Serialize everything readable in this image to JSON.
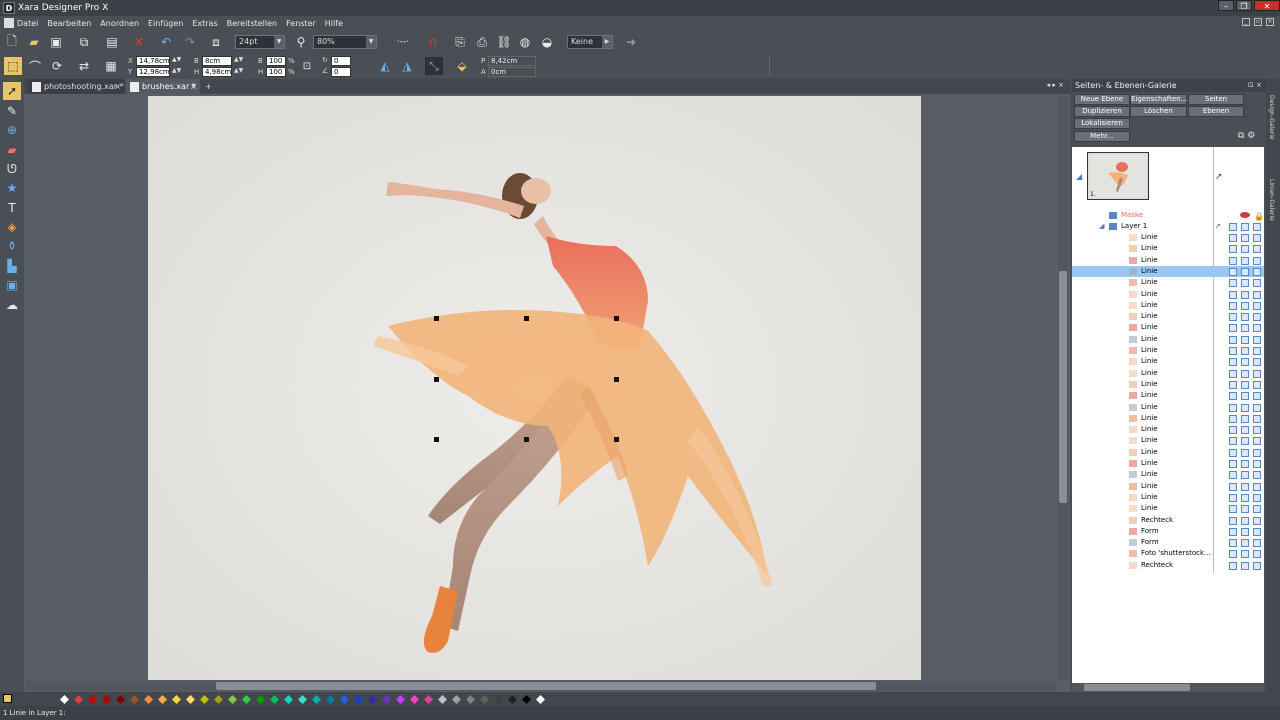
{
  "window": {
    "title": "Xara Designer Pro X",
    "app_icon": "D"
  },
  "menu": [
    "Datei",
    "Bearbeiten",
    "Anordnen",
    "Einfügen",
    "Extras",
    "Bereitstellen",
    "Fenster",
    "Hilfe"
  ],
  "toolbar": {
    "line_width": "24pt",
    "zoom": "80%",
    "blend": "Keine"
  },
  "infobar": {
    "x_label": "X",
    "x_value": "14,78cm",
    "y_label": "Y",
    "y_value": "12,98cm",
    "b_label": "B",
    "b_value": "8cm",
    "h_label": "H",
    "h_value": "4,98cm",
    "b_pct": "100",
    "h_pct": "100",
    "rot_value": "0",
    "skew_value": "0",
    "p_label": "P",
    "p_value": "8,42cm",
    "a_label": "A",
    "a_value": "0cm"
  },
  "tabs": [
    {
      "label": "photoshooting.xar *"
    },
    {
      "label": "brushes.xar *"
    }
  ],
  "gallery": {
    "title": "Seiten- & Ebenen-Galerie",
    "buttons": [
      "Neue Ebene",
      "Eigenschaften...",
      "Seiten",
      "Duplizieren",
      "Löschen",
      "Ebenen",
      "Lokalisieren",
      "Mehr..."
    ],
    "page_number": "1.",
    "mask_label": "Maske",
    "layer_label": "Layer 1",
    "objects": [
      "Linie",
      "Linie",
      "Linie",
      "Linie",
      "Linie",
      "Linie",
      "Linie",
      "Linie",
      "Linie",
      "Linie",
      "Linie",
      "Linie",
      "Linie",
      "Linie",
      "Linie",
      "Linie",
      "Linie",
      "Linie",
      "Linie",
      "Linie",
      "Linie",
      "Linie",
      "Linie",
      "Linie",
      "Linie",
      "Rechteck",
      "Form",
      "Form",
      "Foto 'shutterstock...",
      "Rechteck"
    ],
    "selected_index": 3,
    "side_tabs": [
      "Design-Galerie",
      "Linien-Galerie"
    ]
  },
  "status": {
    "text": "1 Linie in Layer 1:"
  },
  "colors": {
    "accent": "#e9c46a",
    "selection": "#99c9f3",
    "tutu": "#f2b479",
    "leotard": "#e4735a"
  }
}
